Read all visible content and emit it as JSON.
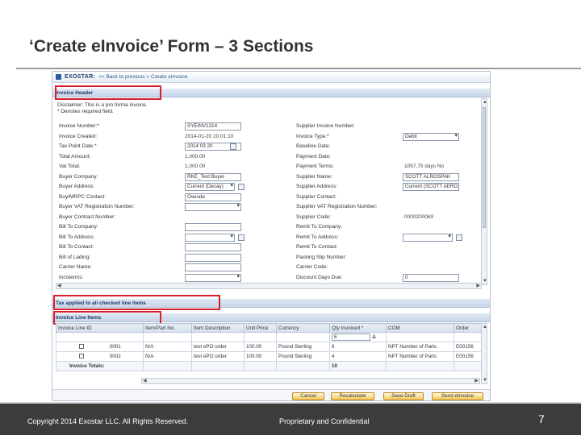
{
  "slide": {
    "title": "‘Create eInvoice’ Form – 3 Sections",
    "copyright": "Copyright 2014 Exostar LLC. All Rights Reserved.",
    "confidential": "Proprietary and Confidential",
    "page_number": "7"
  },
  "app": {
    "brand": "EXOSTAR:",
    "breadcrumb": "<< Back to previous > Create eInvoice"
  },
  "sections": {
    "invoice_header": "Invoice Header",
    "tax": "Tax applied to all checked line items",
    "line_items": "Invoice Line Items"
  },
  "notice": {
    "line1": "Disclaimer: This is a pro forma invoice.",
    "line2": "* Denotes required field."
  },
  "form": {
    "left": [
      {
        "label": "Invoice Number:*",
        "value": "SYEINV1314",
        "kind": "input"
      },
      {
        "label": "Invoice Created:",
        "value": "2014-01-20 20:01:10",
        "kind": "text"
      },
      {
        "label": "Tax Point Date *",
        "value": "2014 03 20",
        "kind": "date"
      },
      {
        "label": "Total Amount:",
        "value": "1,000.00",
        "kind": "text"
      },
      {
        "label": "Vat Total:",
        "value": "1,000.00",
        "kind": "text"
      },
      {
        "label": "Buyer Company:",
        "value": "RKE_Test Buyer",
        "kind": "input"
      },
      {
        "label": "Buyer Address:",
        "value": "Current (Decay)",
        "kind": "select-icon"
      },
      {
        "label": "Buy/MRPC Contact:",
        "value": "Oseude",
        "kind": "input"
      },
      {
        "label": "Buyer VAT Registration Number:",
        "value": "",
        "kind": "select"
      },
      {
        "label": "Buyer Contract Number:",
        "value": "",
        "kind": "none"
      },
      {
        "label": "Bill To Company:",
        "value": "",
        "kind": "input"
      },
      {
        "label": "Bill To Address:",
        "value": "",
        "kind": "select-icon"
      },
      {
        "label": "Bill To Contact:",
        "value": "",
        "kind": "input"
      },
      {
        "label": "Bill of Lading:",
        "value": "",
        "kind": "input"
      },
      {
        "label": "Carrier Name:",
        "value": "",
        "kind": "input"
      },
      {
        "label": "Incoterms:",
        "value": "",
        "kind": "select"
      }
    ],
    "right": [
      {
        "label": "Supplier Invoice Number:",
        "value": "",
        "kind": "none"
      },
      {
        "label": "Invoice Type:*",
        "value": "Debit",
        "kind": "select"
      },
      {
        "label": "Baseline Date:",
        "value": "",
        "kind": "none"
      },
      {
        "label": "Payment Date:",
        "value": "",
        "kind": "none"
      },
      {
        "label": "Payment Terms:",
        "value": "1057.75 days No",
        "kind": "text"
      },
      {
        "label": "Supplier Name:",
        "value": "SCOTT ALROSPAK",
        "kind": "input"
      },
      {
        "label": "Supplier Address:",
        "value": "Current (SCOTT AEROSPA",
        "kind": "input"
      },
      {
        "label": "Supplier Contact:",
        "value": "",
        "kind": "none"
      },
      {
        "label": "Supplier VAT Registration Number:",
        "value": "",
        "kind": "none"
      },
      {
        "label": "Supplier Code:",
        "value": "0000200069",
        "kind": "text"
      },
      {
        "label": "Remit To Company:",
        "value": "",
        "kind": "none"
      },
      {
        "label": "Remit To Address:",
        "value": "",
        "kind": "select-icon"
      },
      {
        "label": "Remit To Contact:",
        "value": "",
        "kind": "none"
      },
      {
        "label": "Packing Slip Number:",
        "value": "",
        "kind": "none"
      },
      {
        "label": "Carrier Code:",
        "value": "",
        "kind": "none"
      },
      {
        "label": "Discount Days Due:",
        "value": "0",
        "kind": "input"
      }
    ]
  },
  "line_items": {
    "headers": [
      "Invoice Line ID",
      "Item/Part No.",
      "Item Description",
      "Unit Price",
      "Currency",
      "Qty Invoiced *",
      "COM",
      "Order"
    ],
    "qty_input": "6",
    "rows": [
      {
        "id": "0001",
        "part": "N/A",
        "desc": "test ePO order",
        "price": "100.00",
        "currency": "Pound Sterling",
        "qty": "6",
        "com": "NPT Number of Parts",
        "order": "E00156"
      },
      {
        "id": "0002",
        "part": "N/A",
        "desc": "test ePO order",
        "price": "100.00",
        "currency": "Pound Sterling",
        "qty": "4",
        "com": "NPT Number of Parts",
        "order": "E00156"
      }
    ],
    "totals_label": "Invoice Totals:",
    "totals_qty": "10"
  },
  "buttons": {
    "cancel": "Cancel",
    "recalculate": "Recalculate",
    "save_draft": "Save Draft",
    "send": "Send eInvoice"
  },
  "colors": {
    "highlight": "#d81e2a",
    "section_header": "#c8d6ea",
    "footer": "#3c3c3c",
    "button": "#f2c75a"
  }
}
